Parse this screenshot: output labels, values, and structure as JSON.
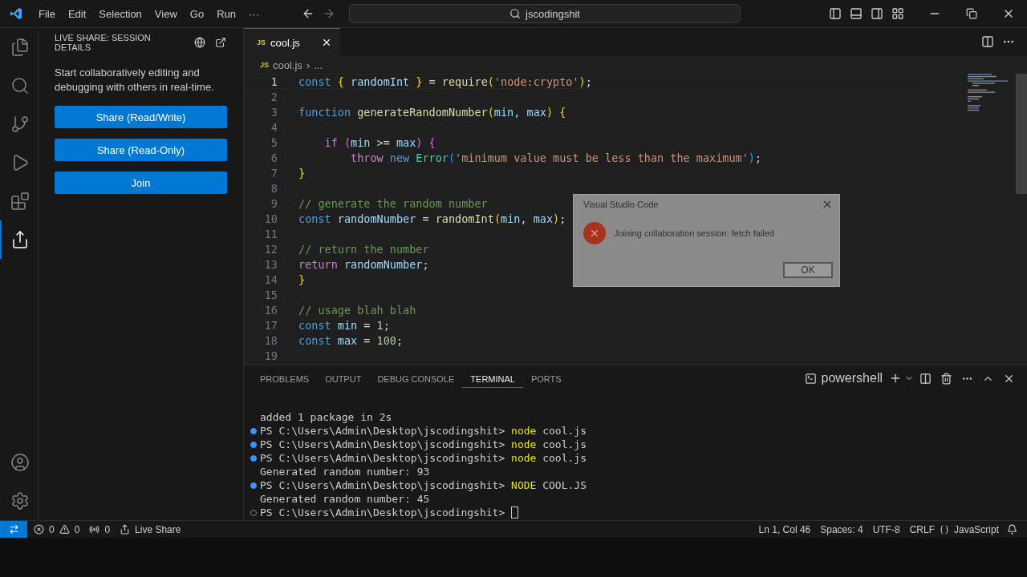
{
  "menu": [
    "File",
    "Edit",
    "Selection",
    "View",
    "Go",
    "Run",
    "···"
  ],
  "command_center": {
    "text": "jscodingshit"
  },
  "activity_bar": [
    {
      "kind": "files",
      "selected": false
    },
    {
      "kind": "search",
      "selected": false
    },
    {
      "kind": "branch",
      "selected": false
    },
    {
      "kind": "run",
      "selected": false
    },
    {
      "kind": "extensions",
      "selected": false
    },
    {
      "kind": "share",
      "selected": true
    }
  ],
  "sidebar": {
    "title": "LIVE SHARE: SESSION DETAILS",
    "description": "Start collaboratively editing and debugging with others in real-time.",
    "buttons": [
      "Share (Read/Write)",
      "Share (Read-Only)",
      "Join"
    ]
  },
  "editor_tabs": [
    {
      "badge": "JS",
      "label": "cool.js",
      "selected": true
    }
  ],
  "breadcrumb": {
    "badge": "JS",
    "file": "cool.js",
    "separator": "›",
    "rest": "..."
  },
  "code_lines": [
    {
      "number": "1",
      "current": true,
      "tokens": [
        {
          "kind": "keyword",
          "text": "const "
        },
        {
          "kind": "bracket",
          "text": "{"
        },
        {
          "kind": "variable",
          "text": " randomInt "
        },
        {
          "kind": "bracket",
          "text": "}"
        },
        {
          "kind": "plain",
          "text": " = "
        },
        {
          "kind": "function",
          "text": "require"
        },
        {
          "kind": "bracket",
          "text": "("
        },
        {
          "kind": "string",
          "text": "'node:crypto'"
        },
        {
          "kind": "bracket",
          "text": ")"
        },
        {
          "kind": "plain",
          "text": ";"
        }
      ]
    },
    {
      "number": "2",
      "current": false
    },
    {
      "number": "3",
      "current": false,
      "tokens": [
        {
          "kind": "keyword",
          "text": "function "
        },
        {
          "kind": "function",
          "text": "generateRandomNumber"
        },
        {
          "kind": "bracket",
          "text": "("
        },
        {
          "kind": "variable",
          "text": "min"
        },
        {
          "kind": "plain",
          "text": ", "
        },
        {
          "kind": "variable",
          "text": "max"
        },
        {
          "kind": "bracket",
          "text": ")"
        },
        {
          "kind": "bracket",
          "text": " {"
        }
      ]
    },
    {
      "number": "4",
      "current": false
    },
    {
      "number": "5",
      "current": false,
      "tokens": [
        {
          "kind": "control",
          "text": "    if "
        },
        {
          "kind": "bracket2",
          "text": "("
        },
        {
          "kind": "variable",
          "text": "min"
        },
        {
          "kind": "plain",
          "text": " >= "
        },
        {
          "kind": "variable",
          "text": "max"
        },
        {
          "kind": "bracket2",
          "text": ")"
        },
        {
          "kind": "bracket2",
          "text": " {"
        }
      ]
    },
    {
      "number": "6",
      "current": false,
      "tokens": [
        {
          "kind": "control",
          "text": "        throw "
        },
        {
          "kind": "keyword",
          "text": "new "
        },
        {
          "kind": "class",
          "text": "Error"
        },
        {
          "kind": "bracket3",
          "text": "("
        },
        {
          "kind": "string",
          "text": "'minimum value must be less than the maximum'"
        },
        {
          "kind": "bracket3",
          "text": ")"
        },
        {
          "kind": "plain",
          "text": ";"
        }
      ]
    },
    {
      "number": "7",
      "current": false,
      "tokens": [
        {
          "kind": "bracket",
          "text": "}"
        }
      ]
    },
    {
      "number": "8",
      "current": false
    },
    {
      "number": "9",
      "current": false,
      "tokens": [
        {
          "kind": "comment",
          "text": "// generate the random number"
        }
      ]
    },
    {
      "number": "10",
      "current": false,
      "tokens": [
        {
          "kind": "keyword",
          "text": "const "
        },
        {
          "kind": "variable",
          "text": "randomNumber"
        },
        {
          "kind": "plain",
          "text": " = "
        },
        {
          "kind": "function",
          "text": "randomInt"
        },
        {
          "kind": "bracket",
          "text": "("
        },
        {
          "kind": "variable",
          "text": "min"
        },
        {
          "kind": "plain",
          "text": ", "
        },
        {
          "kind": "variable",
          "text": "max"
        },
        {
          "kind": "bracket",
          "text": ")"
        },
        {
          "kind": "plain",
          "text": ";"
        }
      ]
    },
    {
      "number": "11",
      "current": false
    },
    {
      "number": "12",
      "current": false,
      "tokens": [
        {
          "kind": "comment",
          "text": "// return the number"
        }
      ]
    },
    {
      "number": "13",
      "current": false,
      "tokens": [
        {
          "kind": "control",
          "text": "return "
        },
        {
          "kind": "variable",
          "text": "randomNumber"
        },
        {
          "kind": "plain",
          "text": ";"
        }
      ]
    },
    {
      "number": "14",
      "current": false,
      "tokens": [
        {
          "kind": "bracket",
          "text": "}"
        }
      ]
    },
    {
      "number": "15",
      "current": false
    },
    {
      "number": "16",
      "current": false,
      "tokens": [
        {
          "kind": "comment",
          "text": "// usage blah blah"
        }
      ]
    },
    {
      "number": "17",
      "current": false,
      "tokens": [
        {
          "kind": "keyword",
          "text": "const "
        },
        {
          "kind": "variable",
          "text": "min"
        },
        {
          "kind": "plain",
          "text": " = "
        },
        {
          "kind": "number",
          "text": "1"
        },
        {
          "kind": "plain",
          "text": ";"
        }
      ]
    },
    {
      "number": "18",
      "current": false,
      "tokens": [
        {
          "kind": "keyword",
          "text": "const "
        },
        {
          "kind": "variable",
          "text": "max"
        },
        {
          "kind": "plain",
          "text": " = "
        },
        {
          "kind": "number",
          "text": "100"
        },
        {
          "kind": "plain",
          "text": ";"
        }
      ]
    },
    {
      "number": "19",
      "current": false
    }
  ],
  "dialog": {
    "title": "Visual Studio Code",
    "message": "Joining collaboration session: fetch failed",
    "button": "OK"
  },
  "panel_tabs": [
    {
      "label": "PROBLEMS",
      "selected": false
    },
    {
      "label": "OUTPUT",
      "selected": false
    },
    {
      "label": "DEBUG CONSOLE",
      "selected": false
    },
    {
      "label": "TERMINAL",
      "selected": true
    },
    {
      "label": "PORTS",
      "selected": false
    }
  ],
  "terminal_name": "powershell",
  "terminal_lines": [
    {
      "kind": "output",
      "text": "added 1 package in 2s"
    },
    {
      "kind": "prompt",
      "finished": true,
      "path": "PS C:\\Users\\Admin\\Desktop\\jscodingshit>",
      "command": "node",
      "args": "cool.js"
    },
    {
      "kind": "prompt",
      "finished": true,
      "path": "PS C:\\Users\\Admin\\Desktop\\jscodingshit>",
      "command": "node",
      "args": "cool.js"
    },
    {
      "kind": "prompt",
      "finished": true,
      "path": "PS C:\\Users\\Admin\\Desktop\\jscodingshit>",
      "command": "node",
      "args": "cool.js"
    },
    {
      "kind": "output",
      "text": "Generated random number: 93"
    },
    {
      "kind": "prompt",
      "finished": true,
      "path": "PS C:\\Users\\Admin\\Desktop\\jscodingshit>",
      "command": "NODE",
      "args": "COOL.JS"
    },
    {
      "kind": "output",
      "text": "Generated random number: 45"
    },
    {
      "kind": "prompt",
      "finished": false,
      "path": "PS C:\\Users\\Admin\\Desktop\\jscodingshit>"
    }
  ],
  "status_bar": {
    "errors": "0",
    "warnings": "0",
    "ports": "0",
    "live_share": "Live Share",
    "position": "Ln 1, Col 46",
    "indent": "Spaces: 4",
    "encoding": "UTF-8",
    "eol": "CRLF",
    "language": "JavaScript"
  }
}
